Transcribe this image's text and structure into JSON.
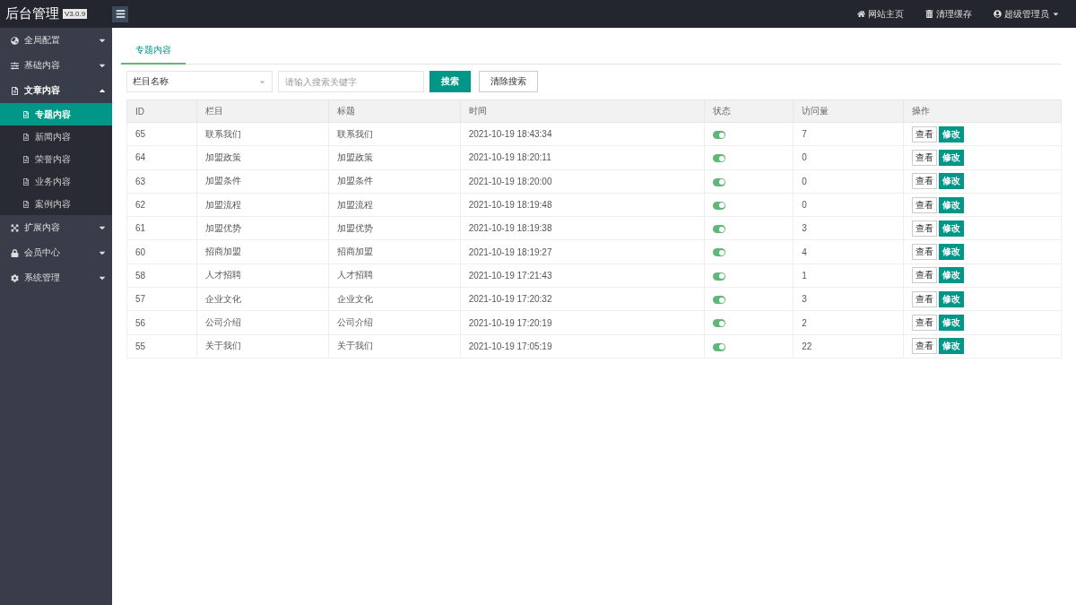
{
  "header": {
    "title": "后台管理",
    "version": "V3.0.9",
    "links": [
      {
        "label": "网站主页"
      },
      {
        "label": "清理缓存"
      },
      {
        "label": "超级管理员",
        "caret": true
      }
    ]
  },
  "sidebar": {
    "items": [
      {
        "label": "全局配置",
        "expanded": false
      },
      {
        "label": "基础内容",
        "expanded": false
      },
      {
        "label": "文章内容",
        "expanded": true,
        "children": [
          {
            "label": "专题内容",
            "selected": true
          },
          {
            "label": "新闻内容",
            "selected": false
          },
          {
            "label": "荣誉内容",
            "selected": false
          },
          {
            "label": "业务内容",
            "selected": false
          },
          {
            "label": "案例内容",
            "selected": false
          }
        ]
      },
      {
        "label": "扩展内容",
        "expanded": false
      },
      {
        "label": "会员中心",
        "expanded": false
      },
      {
        "label": "系统管理",
        "expanded": false
      }
    ]
  },
  "tabs": [
    {
      "label": "专题内容",
      "selected": true
    }
  ],
  "search": {
    "select": "栏目名称",
    "placeholder": "请输入搜索关键字",
    "buttons": [
      "搜索",
      "清除搜索"
    ]
  },
  "table": {
    "columns": [
      "ID",
      "栏目",
      "标题",
      "时间",
      "状态",
      "访问量",
      "操作"
    ],
    "rows": [
      {
        "id": "65",
        "column": "联系我们",
        "title": "联系我们",
        "time": "2021-10-19 18:43:34",
        "on": true,
        "views": "7",
        "actions": [
          "查看",
          "修改"
        ]
      },
      {
        "id": "64",
        "column": "加盟政策",
        "title": "加盟政策",
        "time": "2021-10-19 18:20:11",
        "on": true,
        "views": "0",
        "actions": [
          "查看",
          "修改"
        ]
      },
      {
        "id": "63",
        "column": "加盟条件",
        "title": "加盟条件",
        "time": "2021-10-19 18:20:00",
        "on": true,
        "views": "0",
        "actions": [
          "查看",
          "修改"
        ]
      },
      {
        "id": "62",
        "column": "加盟流程",
        "title": "加盟流程",
        "time": "2021-10-19 18:19:48",
        "on": true,
        "views": "0",
        "actions": [
          "查看",
          "修改"
        ]
      },
      {
        "id": "61",
        "column": "加盟优势",
        "title": "加盟优势",
        "time": "2021-10-19 18:19:38",
        "on": true,
        "views": "3",
        "actions": [
          "查看",
          "修改"
        ]
      },
      {
        "id": "60",
        "column": "招商加盟",
        "title": "招商加盟",
        "time": "2021-10-19 18:19:27",
        "on": true,
        "views": "4",
        "actions": [
          "查看",
          "修改"
        ]
      },
      {
        "id": "58",
        "column": "人才招聘",
        "title": "人才招聘",
        "time": "2021-10-19 17:21:43",
        "on": true,
        "views": "1",
        "actions": [
          "查看",
          "修改"
        ]
      },
      {
        "id": "57",
        "column": "企业文化",
        "title": "企业文化",
        "time": "2021-10-19 17:20:32",
        "on": true,
        "views": "3",
        "actions": [
          "查看",
          "修改"
        ]
      },
      {
        "id": "56",
        "column": "公司介绍",
        "title": "公司介绍",
        "time": "2021-10-19 17:20:19",
        "on": true,
        "views": "2",
        "actions": [
          "查看",
          "修改"
        ]
      },
      {
        "id": "55",
        "column": "关于我们",
        "title": "关于我们",
        "time": "2021-10-19 17:05:19",
        "on": true,
        "views": "22",
        "actions": [
          "查看",
          "修改"
        ]
      }
    ]
  }
}
